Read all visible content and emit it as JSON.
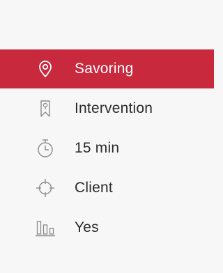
{
  "colors": {
    "background": "#f7f7f7",
    "active_background": "#c8293d",
    "active_text": "#ffffff",
    "text": "#2b2b2b",
    "icon": "#8a8a8a"
  },
  "menu": {
    "items": [
      {
        "label": "Savoring",
        "icon": "location-pin-icon",
        "active": true
      },
      {
        "label": "Intervention",
        "icon": "bookmark-icon",
        "active": false
      },
      {
        "label": "15 min",
        "icon": "timer-icon",
        "active": false
      },
      {
        "label": "Client",
        "icon": "crosshair-icon",
        "active": false
      },
      {
        "label": "Yes",
        "icon": "bar-chart-icon",
        "active": false
      }
    ]
  }
}
